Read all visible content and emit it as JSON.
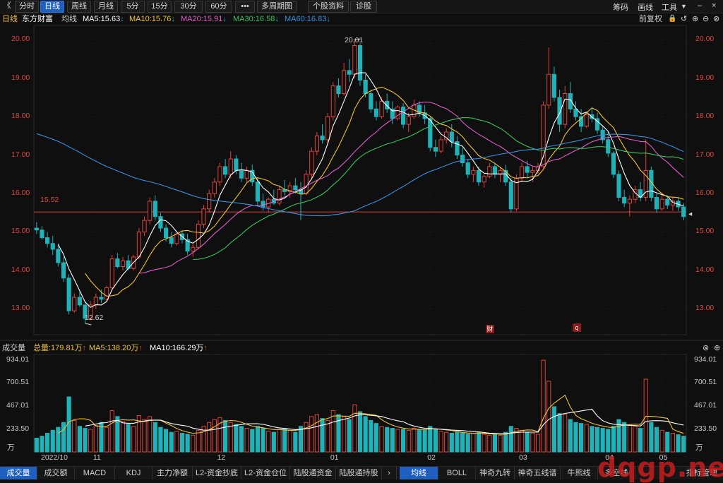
{
  "toolbar": {
    "back_glyph": "《",
    "periods": [
      "分时",
      "日线",
      "周线",
      "月线",
      "5分",
      "15分",
      "30分",
      "60分"
    ],
    "active_period": "日线",
    "more": "•••",
    "multi_period": "多周期图",
    "stock_info": "个股资料",
    "diagnose": "诊股",
    "right": [
      "筹码",
      "画线",
      "工具"
    ]
  },
  "ma_legend": {
    "period": "日线",
    "stock_name": "东方财富",
    "ma_label": "均线",
    "ma5": "MA5:15.63",
    "ma10": "MA10:15.76",
    "ma20": "MA20:15.91",
    "ma30": "MA30:16.58",
    "ma60": "MA60:16.83",
    "adjust": "前复权"
  },
  "colors": {
    "up": "#e0443c",
    "down": "#1fb3b9",
    "ma5": "#ffffff",
    "ma10": "#f2c230",
    "ma20": "#e05cc8",
    "ma30": "#35c45a",
    "ma60": "#3a8fe0",
    "hline": "#e0443c"
  },
  "price_axis": {
    "ticks": [
      "20.00",
      "19.00",
      "18.00",
      "17.00",
      "16.00",
      "15.00",
      "14.00",
      "13.00"
    ]
  },
  "annotations": {
    "high": "20.01",
    "low": "12.62",
    "hline": "15.52"
  },
  "markers": [
    "财",
    "q"
  ],
  "vol_legend": {
    "label": "成交量",
    "total": "总量:179.81万",
    "ma5": "MA5:138.20万",
    "ma10": "MA10:166.29万"
  },
  "vol_axis": {
    "ticks": [
      "934.01",
      "700.51",
      "467.01",
      "233.50"
    ],
    "unit": "万"
  },
  "x_axis": {
    "labels": [
      "2022/10",
      "11",
      "12",
      "01",
      "02",
      "03",
      "04",
      "05"
    ]
  },
  "bottom_tabs": {
    "left": [
      "成交量",
      "成交额",
      "MACD",
      "KDJ",
      "主力净额",
      "L2-资金抄底",
      "L2-资金仓位",
      "陆股通资金",
      "陆股通持股"
    ],
    "arrow": "›",
    "right": [
      "均线",
      "BOLL",
      "神奇九转",
      "神奇五线谱",
      "牛熊线",
      "多空线"
    ],
    "manage": "指标管理"
  },
  "watermark": "dqgp.net",
  "chart_data": {
    "type": "candlestick",
    "ylim": [
      12.4,
      20.3
    ],
    "vol_ylim": [
      0,
      934.01
    ],
    "ohlc": [
      [
        15.1,
        15.25,
        14.95,
        15.05
      ],
      [
        15.05,
        15.15,
        14.8,
        14.85
      ],
      [
        14.85,
        15.0,
        14.6,
        14.7
      ],
      [
        14.7,
        14.9,
        14.4,
        14.55
      ],
      [
        14.55,
        14.7,
        14.1,
        14.2
      ],
      [
        14.2,
        14.35,
        13.7,
        13.8
      ],
      [
        13.8,
        13.9,
        12.85,
        12.95
      ],
      [
        12.95,
        13.4,
        12.9,
        13.3
      ],
      [
        13.3,
        13.45,
        13.05,
        13.1
      ],
      [
        13.1,
        13.2,
        12.62,
        12.75
      ],
      [
        12.75,
        13.2,
        12.7,
        13.1
      ],
      [
        13.1,
        13.4,
        13.0,
        13.3
      ],
      [
        13.3,
        13.5,
        13.15,
        13.25
      ],
      [
        13.25,
        13.6,
        13.2,
        13.55
      ],
      [
        13.55,
        14.4,
        13.5,
        14.3
      ],
      [
        14.3,
        14.45,
        14.05,
        14.1
      ],
      [
        14.1,
        14.35,
        14.0,
        14.25
      ],
      [
        14.25,
        14.4,
        14.0,
        14.05
      ],
      [
        14.05,
        14.4,
        14.0,
        14.35
      ],
      [
        14.35,
        15.1,
        14.3,
        15.0
      ],
      [
        15.0,
        15.4,
        14.9,
        15.3
      ],
      [
        15.3,
        15.9,
        15.2,
        15.8
      ],
      [
        15.8,
        15.95,
        15.3,
        15.4
      ],
      [
        15.4,
        15.5,
        15.0,
        15.1
      ],
      [
        15.1,
        15.2,
        14.75,
        14.85
      ],
      [
        14.85,
        15.0,
        14.6,
        14.7
      ],
      [
        14.7,
        15.0,
        14.65,
        14.95
      ],
      [
        14.95,
        15.05,
        14.7,
        14.8
      ],
      [
        14.8,
        14.95,
        14.4,
        14.5
      ],
      [
        14.5,
        14.7,
        14.35,
        14.6
      ],
      [
        14.6,
        15.3,
        14.55,
        15.2
      ],
      [
        15.2,
        15.7,
        15.1,
        15.6
      ],
      [
        15.6,
        16.1,
        15.5,
        16.0
      ],
      [
        16.0,
        16.4,
        15.9,
        16.3
      ],
      [
        16.3,
        16.8,
        16.2,
        16.7
      ],
      [
        16.7,
        16.9,
        16.4,
        16.5
      ],
      [
        16.5,
        17.1,
        16.4,
        16.9
      ],
      [
        16.9,
        17.0,
        16.5,
        16.6
      ],
      [
        16.6,
        16.8,
        16.3,
        16.4
      ],
      [
        16.4,
        16.7,
        16.3,
        16.6
      ],
      [
        16.6,
        16.75,
        16.2,
        16.3
      ],
      [
        16.3,
        16.4,
        15.7,
        15.8
      ],
      [
        15.8,
        16.0,
        15.55,
        15.65
      ],
      [
        15.65,
        15.9,
        15.5,
        15.85
      ],
      [
        15.85,
        16.1,
        15.7,
        15.75
      ],
      [
        15.75,
        16.2,
        15.7,
        16.1
      ],
      [
        16.1,
        16.35,
        15.95,
        16.05
      ],
      [
        16.05,
        16.3,
        15.9,
        16.2
      ],
      [
        16.2,
        16.4,
        16.0,
        16.1
      ],
      [
        16.1,
        16.3,
        15.3,
        16.0
      ],
      [
        16.0,
        16.6,
        15.95,
        16.5
      ],
      [
        16.5,
        17.2,
        16.4,
        17.1
      ],
      [
        17.1,
        17.6,
        17.0,
        17.5
      ],
      [
        17.5,
        17.8,
        17.3,
        17.4
      ],
      [
        17.4,
        18.1,
        17.3,
        18.0
      ],
      [
        18.0,
        18.9,
        17.9,
        18.8
      ],
      [
        18.8,
        19.0,
        18.5,
        18.6
      ],
      [
        18.6,
        19.4,
        18.55,
        19.2
      ],
      [
        19.2,
        19.5,
        18.9,
        19.1
      ],
      [
        19.1,
        20.01,
        19.0,
        19.85
      ],
      [
        19.85,
        19.9,
        18.8,
        18.95
      ],
      [
        18.95,
        19.1,
        18.5,
        18.6
      ],
      [
        18.6,
        18.7,
        18.1,
        18.2
      ],
      [
        18.2,
        18.4,
        17.9,
        18.0
      ],
      [
        18.0,
        18.5,
        17.95,
        18.4
      ],
      [
        18.4,
        18.6,
        18.1,
        18.2
      ],
      [
        18.2,
        18.4,
        17.8,
        17.95
      ],
      [
        17.95,
        18.3,
        17.9,
        18.25
      ],
      [
        18.25,
        18.35,
        17.7,
        17.8
      ],
      [
        17.8,
        18.1,
        17.6,
        18.0
      ],
      [
        18.0,
        18.45,
        17.95,
        18.3
      ],
      [
        18.3,
        18.4,
        18.0,
        18.1
      ],
      [
        18.1,
        18.3,
        17.8,
        17.95
      ],
      [
        17.95,
        18.0,
        17.1,
        17.2
      ],
      [
        17.2,
        17.4,
        16.95,
        17.1
      ],
      [
        17.1,
        17.5,
        17.05,
        17.4
      ],
      [
        17.4,
        17.7,
        17.3,
        17.6
      ],
      [
        17.6,
        17.8,
        17.2,
        17.35
      ],
      [
        17.35,
        17.5,
        16.9,
        17.0
      ],
      [
        17.0,
        17.2,
        16.7,
        16.8
      ],
      [
        16.8,
        16.9,
        16.4,
        16.5
      ],
      [
        16.5,
        16.7,
        16.3,
        16.6
      ],
      [
        16.6,
        16.7,
        16.2,
        16.3
      ],
      [
        16.3,
        16.5,
        16.15,
        16.45
      ],
      [
        16.45,
        16.8,
        16.4,
        16.7
      ],
      [
        16.7,
        16.8,
        16.4,
        16.5
      ],
      [
        16.5,
        16.7,
        16.3,
        16.6
      ],
      [
        16.6,
        16.75,
        16.2,
        16.3
      ],
      [
        16.3,
        16.4,
        15.5,
        15.6
      ],
      [
        15.6,
        16.5,
        15.55,
        16.4
      ],
      [
        16.4,
        16.8,
        16.3,
        16.7
      ],
      [
        16.7,
        16.85,
        16.4,
        16.55
      ],
      [
        16.55,
        16.7,
        16.3,
        16.6
      ],
      [
        16.6,
        16.8,
        16.5,
        16.7
      ],
      [
        16.7,
        18.4,
        16.65,
        18.3
      ],
      [
        18.3,
        19.8,
        18.2,
        19.1
      ],
      [
        19.1,
        19.3,
        18.4,
        18.5
      ],
      [
        18.5,
        18.7,
        17.6,
        17.8
      ],
      [
        17.8,
        18.8,
        17.7,
        18.6
      ],
      [
        18.6,
        18.9,
        18.1,
        18.2
      ],
      [
        18.2,
        18.4,
        17.9,
        18.0
      ],
      [
        18.0,
        18.2,
        17.6,
        17.75
      ],
      [
        17.75,
        18.1,
        17.7,
        18.05
      ],
      [
        18.05,
        18.25,
        17.85,
        17.95
      ],
      [
        17.95,
        18.1,
        17.55,
        17.65
      ],
      [
        17.65,
        17.75,
        17.3,
        17.4
      ],
      [
        17.4,
        17.6,
        16.95,
        17.05
      ],
      [
        17.05,
        17.1,
        16.4,
        16.5
      ],
      [
        16.5,
        16.6,
        15.8,
        15.9
      ],
      [
        15.9,
        16.1,
        15.65,
        15.75
      ],
      [
        15.75,
        15.95,
        15.4,
        15.85
      ],
      [
        15.85,
        16.2,
        15.75,
        16.1
      ],
      [
        16.1,
        16.3,
        15.8,
        15.9
      ],
      [
        15.9,
        17.4,
        15.8,
        16.6
      ],
      [
        16.6,
        16.7,
        15.8,
        15.9
      ],
      [
        15.9,
        16.0,
        15.5,
        15.6
      ],
      [
        15.6,
        15.95,
        15.55,
        15.85
      ],
      [
        15.85,
        15.95,
        15.6,
        15.7
      ],
      [
        15.7,
        15.9,
        15.55,
        15.8
      ],
      [
        15.8,
        15.9,
        15.55,
        15.65
      ],
      [
        15.65,
        15.75,
        15.3,
        15.4
      ]
    ],
    "volume": [
      140,
      160,
      190,
      220,
      250,
      300,
      560,
      320,
      260,
      240,
      230,
      270,
      300,
      250,
      420,
      360,
      310,
      280,
      260,
      370,
      330,
      360,
      300,
      250,
      230,
      200,
      210,
      190,
      180,
      170,
      220,
      260,
      300,
      330,
      350,
      320,
      300,
      280,
      260,
      240,
      230,
      260,
      240,
      210,
      200,
      230,
      240,
      220,
      200,
      260,
      300,
      360,
      380,
      340,
      320,
      420,
      380,
      360,
      330,
      480,
      410,
      360,
      320,
      290,
      260,
      250,
      240,
      230,
      230,
      220,
      240,
      230,
      220,
      260,
      230,
      210,
      200,
      190,
      200,
      190,
      180,
      190,
      200,
      180,
      170,
      180,
      170,
      200,
      260,
      240,
      220,
      200,
      190,
      180,
      934,
      720,
      460,
      390,
      380,
      330,
      300,
      290,
      280,
      260,
      250,
      240,
      230,
      260,
      330,
      300,
      270,
      260,
      240,
      740,
      300,
      250,
      220,
      200,
      190,
      175,
      160
    ]
  }
}
